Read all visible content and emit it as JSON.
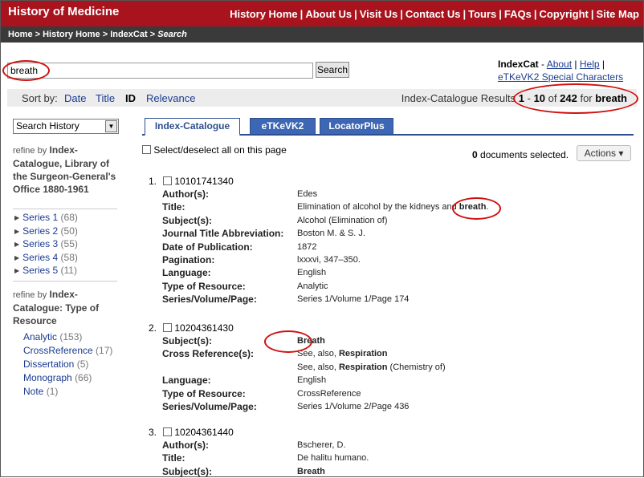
{
  "header": {
    "site_title": "History of Medicine",
    "nav": [
      "History Home",
      "About Us",
      "Visit Us",
      "Contact Us",
      "Tours",
      "FAQs",
      "Copyright",
      "Site Map"
    ]
  },
  "breadcrumb": {
    "items": [
      "Home",
      "History Home",
      "IndexCat"
    ],
    "current": "Search"
  },
  "search": {
    "value": "breath",
    "button_label": "Search"
  },
  "indexcat_box": {
    "title": "IndexCat",
    "dash": "-",
    "about": "About",
    "sep": "|",
    "help": "Help",
    "special_chars": "eTKeVK2 Special Characters"
  },
  "sortbar": {
    "label": "Sort by:",
    "options": [
      "Date",
      "Title",
      "ID",
      "Relevance"
    ],
    "active": "ID",
    "results_prefix": "Index-Catalogue Results",
    "range_start": "1",
    "range_dash": "-",
    "range_end": "10",
    "of_word": "of",
    "total": "242",
    "for_word": "for",
    "query": "breath"
  },
  "sidebar": {
    "history_select": "Search History",
    "refine_by": "refine by",
    "facet1_title": "Index-Catalogue, Library of the Surgeon-General's Office 1880-1961",
    "series": [
      {
        "name": "Series 1",
        "count": "(68)"
      },
      {
        "name": "Series 2",
        "count": "(50)"
      },
      {
        "name": "Series 3",
        "count": "(55)"
      },
      {
        "name": "Series 4",
        "count": "(58)"
      },
      {
        "name": "Series 5",
        "count": "(11)"
      }
    ],
    "facet2_title": "Index-Catalogue: Type of Resource",
    "types": [
      {
        "name": "Analytic",
        "count": "(153)"
      },
      {
        "name": "CrossReference",
        "count": "(17)"
      },
      {
        "name": "Dissertation",
        "count": "(5)"
      },
      {
        "name": "Monograph",
        "count": "(66)"
      },
      {
        "name": "Note",
        "count": "(1)"
      }
    ]
  },
  "tabs": [
    "Index-Catalogue",
    "eTKeVK2",
    "LocatorPlus"
  ],
  "results": {
    "select_all_label": "Select/deselect all on this page",
    "docs_selected_count": "0",
    "docs_selected_label": "documents selected.",
    "actions_label": "Actions ▾",
    "records": [
      {
        "num": "1.",
        "id": "10101741340",
        "fields": [
          {
            "label": "Author(s):",
            "value": "Edes"
          },
          {
            "label": "Title:",
            "value": "Elimination of alcohol by the kidneys and",
            "bold": "breath",
            "tail": "."
          },
          {
            "label": "Subject(s):",
            "value": "Alcohol (Elimination of)"
          },
          {
            "label": "Journal Title Abbreviation:",
            "value": "Boston M. & S. J."
          },
          {
            "label": "Date of Publication:",
            "value": "1872"
          },
          {
            "label": "Pagination:",
            "value": "lxxxvi, 347–350."
          },
          {
            "label": "Language:",
            "value": "English"
          },
          {
            "label": "Type of Resource:",
            "value": "Analytic"
          },
          {
            "label": "Series/Volume/Page:",
            "value": "Series 1/Volume 1/Page 174"
          }
        ]
      },
      {
        "num": "2.",
        "id": "10204361430",
        "fields": [
          {
            "label": "Subject(s):",
            "value": "",
            "bold": "Breath",
            "tail": ""
          },
          {
            "label": "Cross Reference(s):",
            "value": "See, also,",
            "bold": "Respiration",
            "tail": ""
          },
          {
            "label": "",
            "value": "See, also,",
            "bold": "Respiration",
            "tail": " (Chemistry of)"
          },
          {
            "label": "Language:",
            "value": "English"
          },
          {
            "label": "Type of Resource:",
            "value": "CrossReference"
          },
          {
            "label": "Series/Volume/Page:",
            "value": "Series 1/Volume 2/Page 436"
          }
        ]
      },
      {
        "num": "3.",
        "id": "10204361440",
        "fields": [
          {
            "label": "Author(s):",
            "value": "Bscherer, D."
          },
          {
            "label": "Title:",
            "value": "De halitu humano."
          },
          {
            "label": "Subject(s):",
            "value": "",
            "bold": "Breath",
            "tail": ""
          }
        ]
      }
    ]
  }
}
